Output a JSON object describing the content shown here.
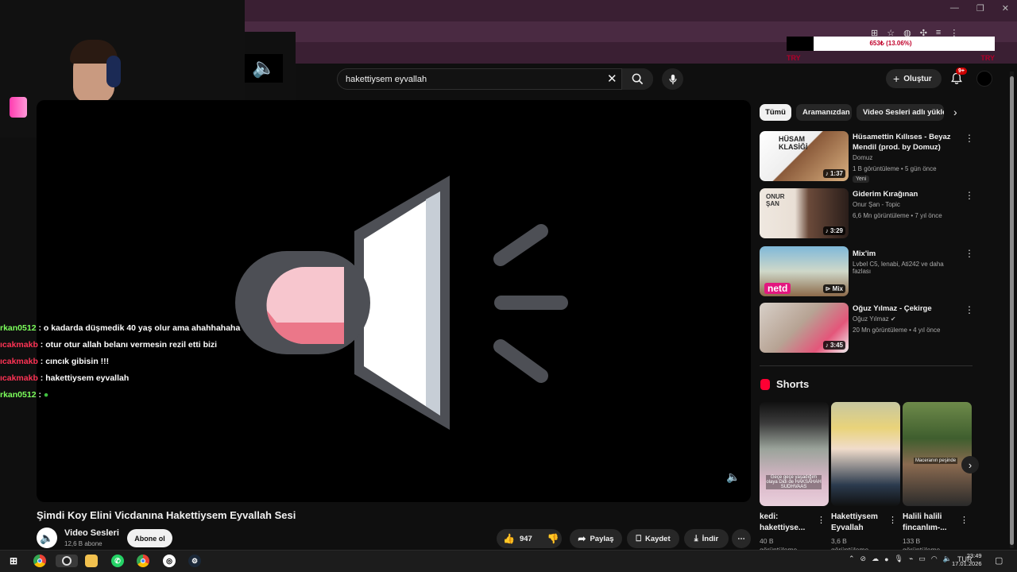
{
  "browser": {
    "window_controls": {
      "minimize": "—",
      "restore": "❐",
      "close": "✕"
    },
    "toolbar_icons": [
      "extension-icon",
      "star-icon",
      "profile-icon",
      "puzzle-icon",
      "media-icon",
      "menu-icon"
    ]
  },
  "overlay": {
    "donation_bar": {
      "text": "653₺ (13.06%)",
      "progress": 0.1306,
      "left_label": "TRY",
      "right_label": "TRY"
    },
    "chat": [
      {
        "user": "rkan0512",
        "message": ": o kadarda düşmedik 40 yaş olur ama ahahhahaha",
        "user_color": "green"
      },
      {
        "user": "ıcakmakb",
        "message": ": otur otur allah belanı vermesin rezil etti bizi",
        "user_color": "red"
      },
      {
        "user": "ıcakmakb",
        "message": ": cıncık gibisin !!!",
        "user_color": "red"
      },
      {
        "user": "ıcakmakb",
        "message": ": hakettiysem eyvallah",
        "user_color": "red"
      },
      {
        "user": "rkan0512",
        "message": ":",
        "user_color": "green"
      }
    ]
  },
  "header": {
    "search_value": "hakettiysem eyvallah",
    "create_label": "Oluştur",
    "notifications_badge": "9+"
  },
  "video": {
    "title": "Şimdi Koy Elini Vicdanına Hakettiysem Eyvallah Sesi",
    "channel": "Video Sesleri",
    "subscribers": "12,6 B abone",
    "subscribe_label": "Abone ol",
    "likes": "947",
    "share_label": "Paylaş",
    "save_label": "Kaydet",
    "download_label": "İndir"
  },
  "sidebar": {
    "chips": [
      "Tümü",
      "Aramanızdan",
      "Video Sesleri adlı yükleyici"
    ],
    "related": [
      {
        "title": "Hüsamettin Kıllıses - Beyaz Mendil (prod. by Domuz)",
        "channel": "Domuz",
        "meta": "1 B görüntüleme • 5 gün önce",
        "duration": "1:37",
        "badge": "Yeni",
        "thumb_text": "HÜSAM KLASİĞİ"
      },
      {
        "title": "Giderim Kırağınan",
        "channel": "Onur Şan - Topic",
        "meta": "6,6 Mn görüntüleme • 7 yıl önce",
        "duration": "3:29",
        "thumb_text": "ONUR ŞAN"
      },
      {
        "title": "Mix'im",
        "channel": "Lvbel C5, lenabi, Ati242 ve daha fazlası",
        "meta": "",
        "duration": "Mix",
        "thumb_text": "netd"
      },
      {
        "title": "Oğuz Yılmaz - Çekirge",
        "channel": "Oğuz Yılmaz",
        "meta": "20 Mn görüntüleme • 4 yıl önce",
        "duration": "3:45",
        "thumb_text": ""
      }
    ],
    "shorts_heading": "Shorts",
    "shorts": [
      {
        "title": "kedi: hakettiyse...",
        "views": "40 B",
        "views2": "görüntüleme",
        "caption": "Geçe geçe yaşadığım olaya Didi de HAKSAHAH SUDHVAAS"
      },
      {
        "title": "Hakettiysem Eyvallah",
        "views": "3,6 B",
        "views2": "görüntüleme",
        "caption": ""
      },
      {
        "title": "Halili halili fincanlım-...",
        "views": "133 B",
        "views2": "görüntüleme",
        "caption": "Maceranın peşinde"
      }
    ]
  },
  "taskbar": {
    "lang": "TUR",
    "time": "23:49",
    "date": "17.01.2026",
    "apps": [
      "start-icon",
      "chrome-icon",
      "obs-icon",
      "files-icon",
      "whatsapp-icon",
      "chrome-icon-2",
      "ubisoft-icon",
      "steam-icon"
    ]
  },
  "colors": {
    "background": "#0f0f0f",
    "accent_red": "#cc0000",
    "browser_frame": "#3a1f33"
  }
}
